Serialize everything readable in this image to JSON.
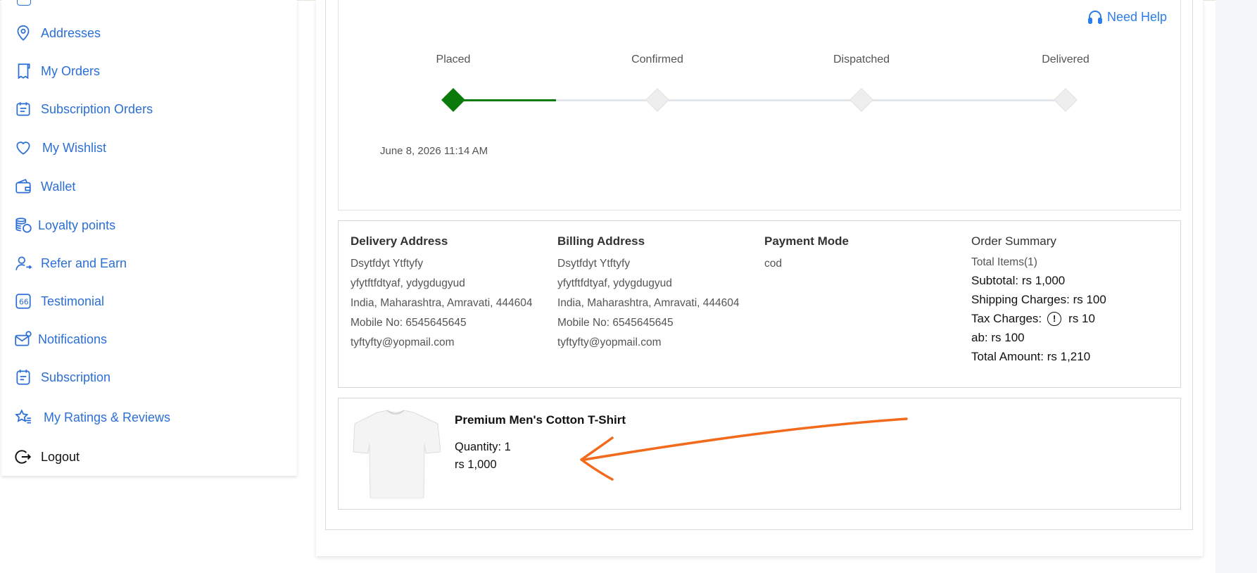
{
  "sidebar": {
    "items": [
      {
        "label": "Addresses",
        "icon": "location-pin-icon"
      },
      {
        "label": "My Orders",
        "icon": "receipt-icon"
      },
      {
        "label": "Subscription Orders",
        "icon": "calendar-list-icon"
      },
      {
        "label": "My Wishlist",
        "icon": "heart-icon"
      },
      {
        "label": "Wallet",
        "icon": "wallet-icon"
      },
      {
        "label": "Loyalty points",
        "icon": "coins-icon"
      },
      {
        "label": "Refer and Earn",
        "icon": "user-share-icon"
      },
      {
        "label": "Testimonial",
        "icon": "quote-icon"
      },
      {
        "label": "Notifications",
        "icon": "mail-bell-icon"
      },
      {
        "label": "Subscription",
        "icon": "subscription-icon"
      },
      {
        "label": "My Ratings & Reviews",
        "icon": "star-list-icon"
      },
      {
        "label": "Logout",
        "icon": "logout-icon"
      }
    ]
  },
  "help": {
    "label": "Need Help",
    "icon": "headphones-icon"
  },
  "tracker": {
    "steps": [
      {
        "label": "Placed",
        "done": true
      },
      {
        "label": "Confirmed",
        "done": false
      },
      {
        "label": "Dispatched",
        "done": false
      },
      {
        "label": "Delivered",
        "done": false
      }
    ],
    "placed_date": "June 8, 2026 11:14 AM",
    "active_color": "#0a7a0a",
    "inactive_color": "#e3e7ec"
  },
  "delivery": {
    "title": "Delivery Address",
    "name": "Dsytfdyt Ytftyfy",
    "line1": "yfytftfdtyaf, ydygdugyud",
    "line2": "India, Maharashtra, Amravati, 444604",
    "mobile": "Mobile No: 6545645645",
    "email": "tyftyfty@yopmail.com"
  },
  "billing": {
    "title": "Billing Address",
    "name": "Dsytfdyt Ytftyfy",
    "line1": "yfytftfdtyaf, ydygdugyud",
    "line2": "India, Maharashtra, Amravati, 444604",
    "mobile": "Mobile No: 6545645645",
    "email": "tyftyfty@yopmail.com"
  },
  "payment": {
    "title": "Payment Mode",
    "mode": "cod"
  },
  "summary": {
    "title": "Order Summary",
    "total_items": "Total Items(1)",
    "subtotal": "Subtotal: rs 1,000",
    "shipping": "Shipping Charges: rs 100",
    "tax_label": "Tax Charges:",
    "tax_value": "rs 10",
    "ab": "ab: rs 100",
    "total": "Total Amount: rs 1,210"
  },
  "product": {
    "name": "Premium Men's Cotton T-Shirt",
    "quantity": "Quantity: 1",
    "price": "rs 1,000"
  },
  "colors": {
    "accent": "#2b6fd6",
    "annotation": "#f26a1b"
  }
}
